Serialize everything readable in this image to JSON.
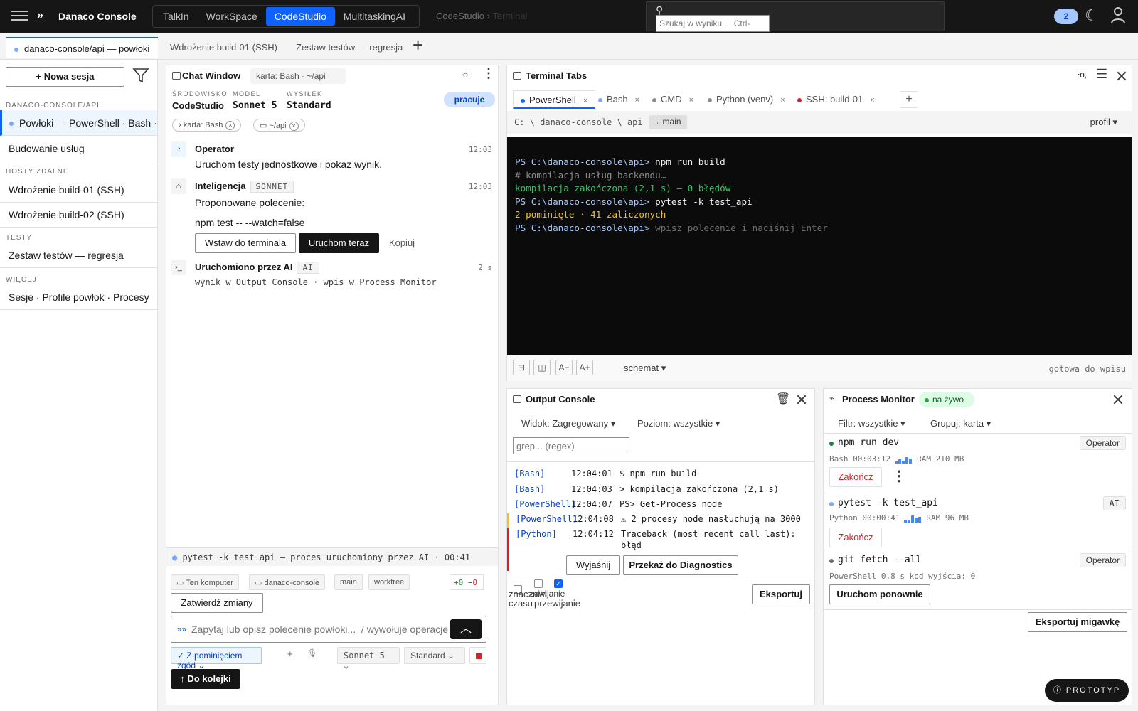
{
  "topbar": {
    "brand": "Danaco Console",
    "brand_icon": "»",
    "apps": [
      "TalkIn",
      "WorkSpace",
      "CodeStudio",
      "MultitaskingAI"
    ],
    "active_app": 2,
    "breadcrumb": {
      "app": "CodeStudio",
      "sep": "›",
      "page": "Terminal"
    },
    "search_placeholder": "Szukaj w wyniku...  Ctrl-",
    "notifications": "2",
    "icons": [
      "menu-icon",
      "search-icon",
      "moon-icon",
      "user-icon"
    ]
  },
  "session_tabs": [
    {
      "label": "danaco-console/api — powłoki",
      "active": true
    },
    {
      "label": "Wdrożenie build-01 (SSH)"
    },
    {
      "label": "Zestaw testów — regresja"
    }
  ],
  "sidebar": {
    "new_session": "+ Nowa sesja",
    "groups": [
      {
        "heading": "DANACO-CONSOLE/API",
        "items": [
          "Powłoki — PowerShell · Bash · CMD",
          "Budowanie usług"
        ]
      },
      {
        "heading": "HOSTY ZDALNE",
        "items": [
          "Wdrożenie build-01 (SSH)",
          "Wdrożenie build-02 (SSH)"
        ]
      },
      {
        "heading": "TESTY",
        "items": [
          "Zestaw testów — regresja"
        ]
      },
      {
        "heading": "WIĘCEJ",
        "items": [
          "Sesje · Profile powłok · Procesy"
        ]
      }
    ]
  },
  "chat": {
    "title": "Chat Window",
    "chip": "karta: Bash · ~/api",
    "status_icon": "ᐧo,",
    "meta": [
      {
        "label": "ŚRODOWISKO",
        "value": "CodeStudio"
      },
      {
        "label": "MODEL",
        "value": "Sonnet 5"
      },
      {
        "label": "WYSIŁEK",
        "value": "Standard"
      }
    ],
    "state": "pracuje",
    "context_chips": [
      "karta: Bash",
      "~/api"
    ],
    "messages": {
      "op_name": "Operator",
      "op_time": "12:03",
      "op_text": "Uruchom testy jednostkowe i pokaż wynik.",
      "ai_name": "Inteligencja",
      "ai_tag": "SONNET",
      "ai_time": "12:03",
      "ai_text1": "Proponowane polecenie:",
      "ai_text2": "npm test -- --watch=false",
      "btn_insert": "Wstaw do terminala",
      "btn_run": "Uruchom teraz",
      "btn_copy": "Kopiuj",
      "run_name": "Uruchomiono przez AI",
      "run_tag": "AI",
      "run_time": "2 s",
      "run_text": "wynik w Output Console · wpis w Process Monitor"
    },
    "ai_bar": "pytest -k test_api — proces uruchomiony przez AI · 00:41",
    "env_chips": [
      "Ten komputer",
      "danaco-console",
      "main",
      "worktree"
    ],
    "diff_add": "+0",
    "diff_del": "−0",
    "commit": "Zatwierdź zmiany",
    "prompt_icon": "»»",
    "prompt_placeholder": "Zapytaj lub opisz polecenie powłoki...  / wywołuje operacje",
    "approve": "✓ Z pominięciem zgód ⌄",
    "model_sel": "Sonnet  5  ⌄",
    "effort_sel": "Standard  ⌄",
    "queue": "↑ Do kolejki"
  },
  "terminal": {
    "title": "Terminal Tabs",
    "status_icon": "ᐧo,",
    "tabs": [
      {
        "label": "PowerShell",
        "color": "#0f62fe"
      },
      {
        "label": "Bash",
        "color": "#78a9ff"
      },
      {
        "label": "CMD",
        "color": "#8d8d8d"
      },
      {
        "label": "Python (venv)",
        "color": "#8d8d8d"
      },
      {
        "label": "SSH: build-01",
        "color": "#da1e28"
      }
    ],
    "path": "C: \\ danaco-console \\ api",
    "branch": "main",
    "profile": "profil ▾",
    "lines": {
      "p1": "PS C:\\danaco-console\\api> ",
      "c1": "npm run build",
      "l2": "# kompilacja usług backendu…",
      "l3": "kompilacja zakończona (2,1 s) — 0 błędów",
      "p4": "PS C:\\danaco-console\\api> ",
      "c4": "pytest -k test_api",
      "l5": "2 pominięte · 41 zaliczonych",
      "p6": "PS C:\\danaco-console\\api> ",
      "c6": "wpisz polecenie i naciśnij Enter"
    },
    "font_minus": "A−",
    "font_plus": "A+",
    "schema": "schemat ▾",
    "ready": "gotowa do wpisu"
  },
  "output": {
    "title": "Output Console",
    "view": "Widok: Zagregowany ▾",
    "level": "Poziom: wszystkie ▾",
    "grep_placeholder": "grep... (regex)",
    "logs": [
      {
        "src": "[Bash]",
        "t": "12:04:01",
        "m": "$ npm run build"
      },
      {
        "src": "[Bash]",
        "t": "12:04:03",
        "m": "> kompilacja zakończona (2,1 s)"
      },
      {
        "src": "[PowerShell]",
        "t": "12:04:07",
        "m": "PS> Get-Process node"
      },
      {
        "src": "[PowerShell]",
        "t": "12:04:08",
        "m": "⚠ 2 procesy node nasłuchują na 3000"
      },
      {
        "src": "[Python]",
        "t": "12:04:12",
        "m": "Traceback (most recent call last): błąd"
      }
    ],
    "btn_explain": "Wyjaśnij",
    "btn_diag": "Przekaż do Diagnostics",
    "chk1": "znaczniki czasu",
    "chk2": "zawijanie",
    "chk3": "przewijanie",
    "export": "Eksportuj"
  },
  "procmon": {
    "title": "Process Monitor",
    "live": "na żywo",
    "filter": "Filtr: wszystkie ▾",
    "group": "Grupuj: karta ▾",
    "procs": [
      {
        "name": "npm run dev",
        "info": "Bash 00:03:12",
        "ram": "RAM 210 MB",
        "badge": "Operator",
        "dot": "#198038",
        "action": "Zakończ",
        "spark": [
          0.3,
          0.5,
          0.4,
          0.8,
          0.6
        ]
      },
      {
        "name": "pytest -k test_api",
        "info": "Python 00:00:41",
        "ram": "RAM 96 MB",
        "badge": "AI",
        "dot": "#78a9ff",
        "action": "Zakończ",
        "spark": [
          0.3,
          0.4,
          0.9,
          0.6,
          0.7
        ]
      },
      {
        "name": "git fetch --all",
        "info": "PowerShell 0,8 s kod wyjścia: 0",
        "ram": "",
        "badge": "Operator",
        "dot": "#6f6f6f",
        "action": "Uruchom ponownie",
        "spark": []
      }
    ],
    "export": "Eksportuj migawkę"
  },
  "prototype": "ⓘ PROTOTYP"
}
